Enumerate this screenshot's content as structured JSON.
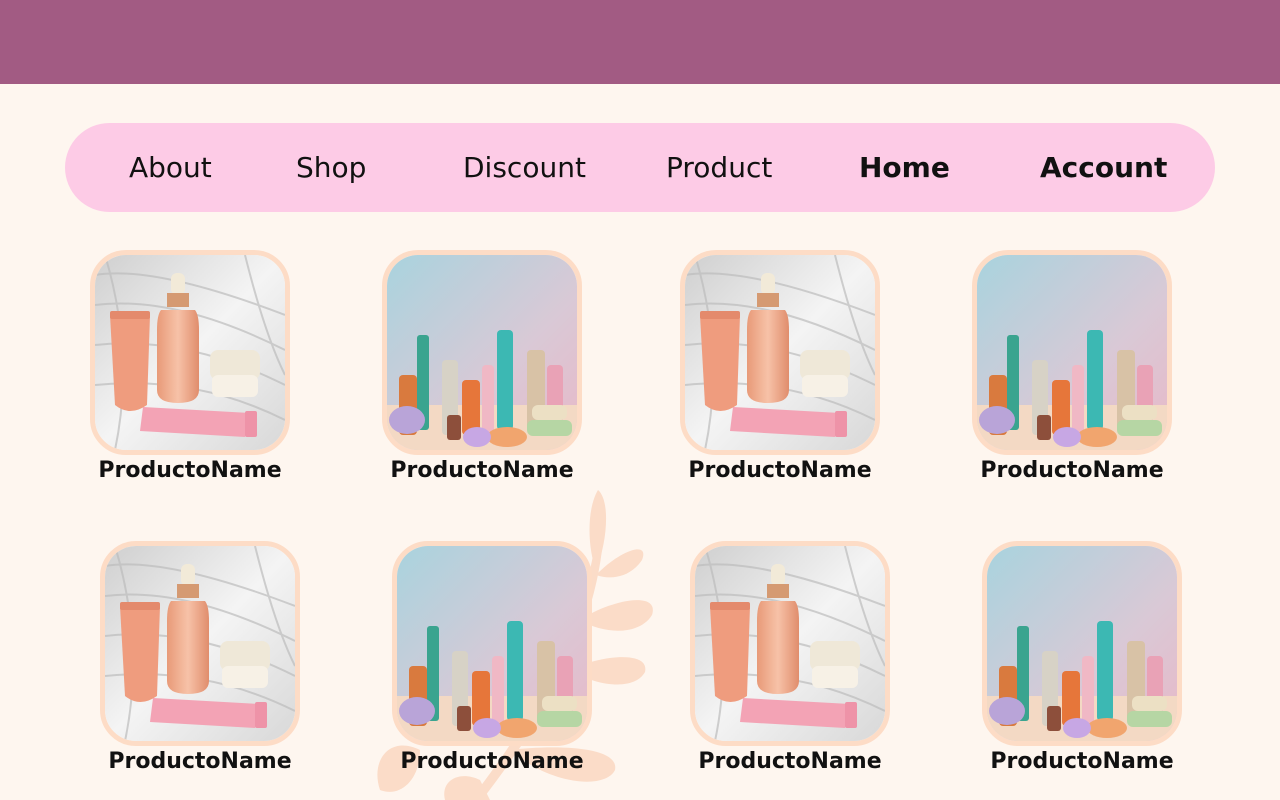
{
  "nav": {
    "items": [
      {
        "label": "About",
        "bold": false
      },
      {
        "label": "Shop",
        "bold": false
      },
      {
        "label": "Discount",
        "bold": false
      },
      {
        "label": "Product",
        "bold": false
      },
      {
        "label": "Home",
        "bold": true
      },
      {
        "label": "Account",
        "bold": true
      }
    ]
  },
  "colors": {
    "header": "#a25b83",
    "background": "#fef6ef",
    "nav_pill": "#fdcbe6",
    "thumb_border": "#fddcc6",
    "leaf": "#fbdcc8"
  },
  "products": [
    {
      "name": "ProductoName",
      "image": "serum-bottle-tube-jar-photo"
    },
    {
      "name": "ProductoName",
      "image": "assorted-cosmetic-bottles-photo"
    },
    {
      "name": "ProductoName",
      "image": "serum-bottle-tube-jar-photo"
    },
    {
      "name": "ProductoName",
      "image": "assorted-cosmetic-bottles-photo"
    },
    {
      "name": "ProductoName",
      "image": "serum-bottle-tube-jar-photo"
    },
    {
      "name": "ProductoName",
      "image": "assorted-cosmetic-bottles-photo"
    },
    {
      "name": "ProductoName",
      "image": "serum-bottle-tube-jar-photo"
    },
    {
      "name": "ProductoName",
      "image": "assorted-cosmetic-bottles-photo"
    }
  ]
}
